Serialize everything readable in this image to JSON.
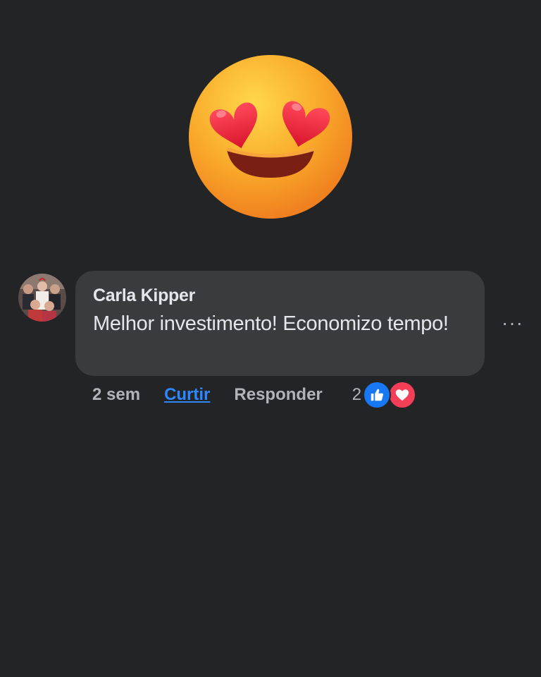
{
  "emoji": {
    "icon": "heart-eyes-emoji-icon"
  },
  "comment": {
    "author": "Carla Kipper",
    "text": "Melhor investimento! Economizo tempo!",
    "time": "2 sem",
    "like_label": "Curtir",
    "reply_label": "Responder",
    "reaction_count": "2",
    "reactions": [
      "like-icon",
      "love-icon"
    ],
    "more_label": "···"
  },
  "colors": {
    "background": "#232426",
    "bubble": "#3a3b3d",
    "link_blue": "#2d88ff",
    "like_blue": "#1877f2",
    "love_red": "#f33e58"
  }
}
